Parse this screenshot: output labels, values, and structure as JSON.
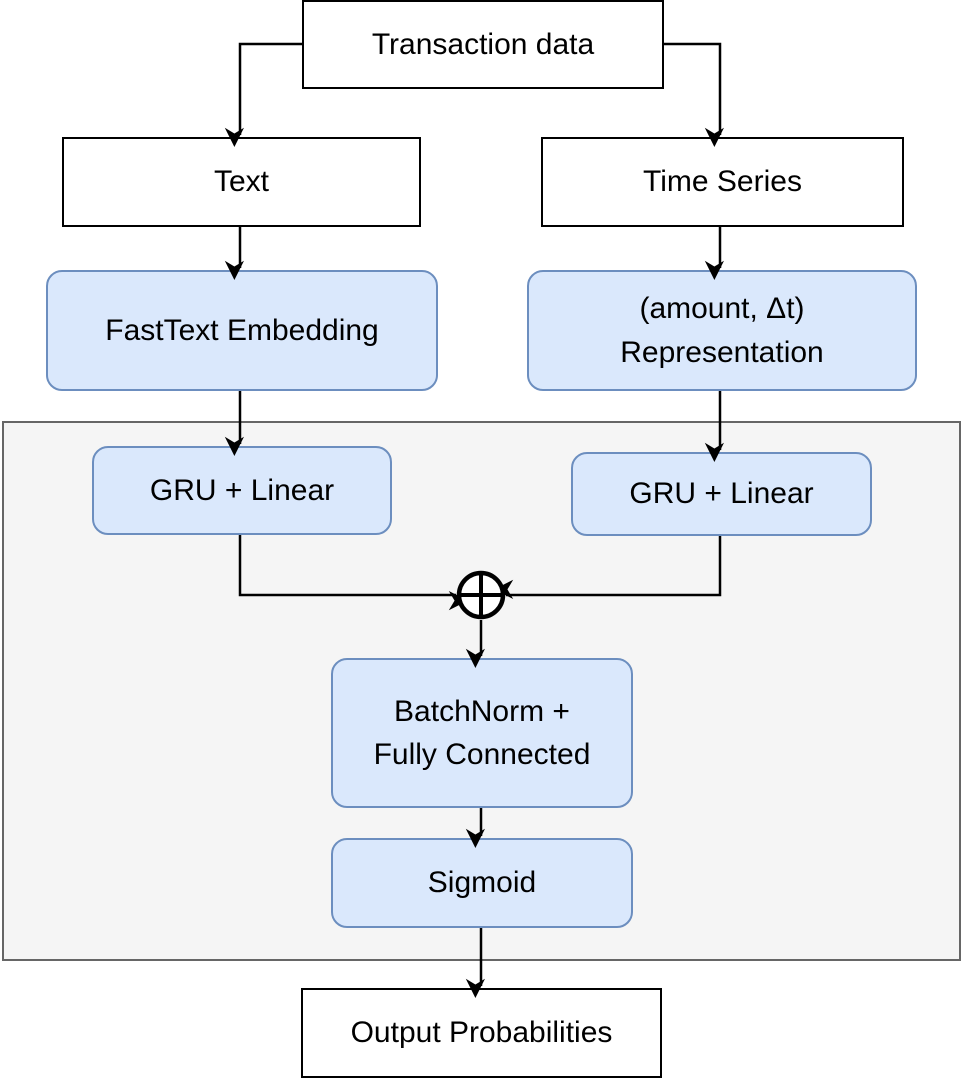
{
  "nodes": {
    "transaction_data": "Transaction data",
    "text": "Text",
    "time_series": "Time Series",
    "fasttext_embedding": "FastText Embedding",
    "amount_dt_line1": "(amount, Δt)",
    "amount_dt_line2": "Representation",
    "gru_left": "GRU + Linear",
    "gru_right": "GRU + Linear",
    "batchnorm_line1": "BatchNorm +",
    "batchnorm_line2": "Fully Connected",
    "sigmoid": "Sigmoid",
    "output": "Output Probabilities"
  },
  "colors": {
    "model_fill": "#dae8fc",
    "model_stroke": "#6c8ebf",
    "group_fill": "#f5f5f5",
    "group_stroke": "#666666"
  },
  "icons": {
    "combine": "circle-plus-icon"
  }
}
